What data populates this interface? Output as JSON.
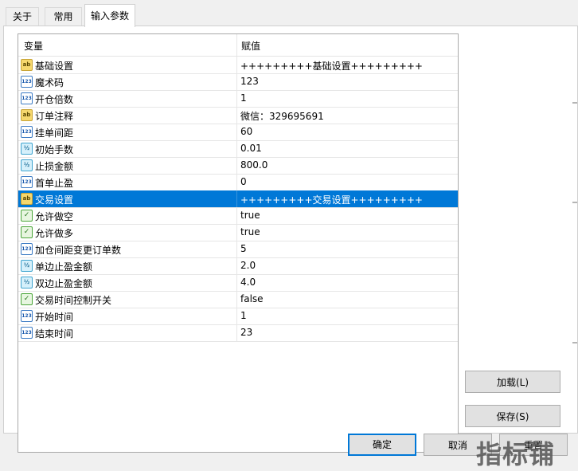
{
  "tabs": [
    {
      "label": "关于"
    },
    {
      "label": "常用"
    },
    {
      "label": "输入参数"
    }
  ],
  "grid": {
    "headers": {
      "variable": "变量",
      "value": "赋值"
    },
    "rows": [
      {
        "type": "string",
        "icon": "ab",
        "name": "基础设置",
        "value": "+++++++++基础设置+++++++++"
      },
      {
        "type": "int",
        "icon": "123",
        "name": "魔术码",
        "value": "123"
      },
      {
        "type": "int",
        "icon": "123",
        "name": "开仓倍数",
        "value": "1"
      },
      {
        "type": "string",
        "icon": "ab",
        "name": "订单注释",
        "value": "微信：329695691"
      },
      {
        "type": "int",
        "icon": "123",
        "name": "挂单间距",
        "value": "60"
      },
      {
        "type": "double",
        "icon": "½",
        "name": "初始手数",
        "value": "0.01"
      },
      {
        "type": "double",
        "icon": "½",
        "name": "止损金额",
        "value": "800.0"
      },
      {
        "type": "int",
        "icon": "123",
        "name": "首单止盈",
        "value": "0"
      },
      {
        "type": "string",
        "icon": "ab",
        "name": "交易设置",
        "value": "+++++++++交易设置+++++++++",
        "selected": true
      },
      {
        "type": "bool",
        "icon": "✓",
        "name": "允许做空",
        "value": "true"
      },
      {
        "type": "bool",
        "icon": "✓",
        "name": "允许做多",
        "value": "true"
      },
      {
        "type": "int",
        "icon": "123",
        "name": "加仓间距变更订单数",
        "value": "5"
      },
      {
        "type": "double",
        "icon": "½",
        "name": "单边止盈金额",
        "value": "2.0"
      },
      {
        "type": "double",
        "icon": "½",
        "name": "双边止盈金额",
        "value": "4.0"
      },
      {
        "type": "bool",
        "icon": "✓",
        "name": "交易时间控制开关",
        "value": "false"
      },
      {
        "type": "int",
        "icon": "123",
        "name": "开始时间",
        "value": "1"
      },
      {
        "type": "int",
        "icon": "123",
        "name": "结束时间",
        "value": "23"
      }
    ]
  },
  "side_buttons": {
    "load": "加载(L)",
    "save": "保存(S)"
  },
  "footer_buttons": {
    "ok": "确定",
    "cancel": "取消",
    "reset": "重置"
  },
  "watermark": "指标铺",
  "colors": {
    "selected_row": "#0078d7",
    "primary_border": "#0078d7"
  }
}
